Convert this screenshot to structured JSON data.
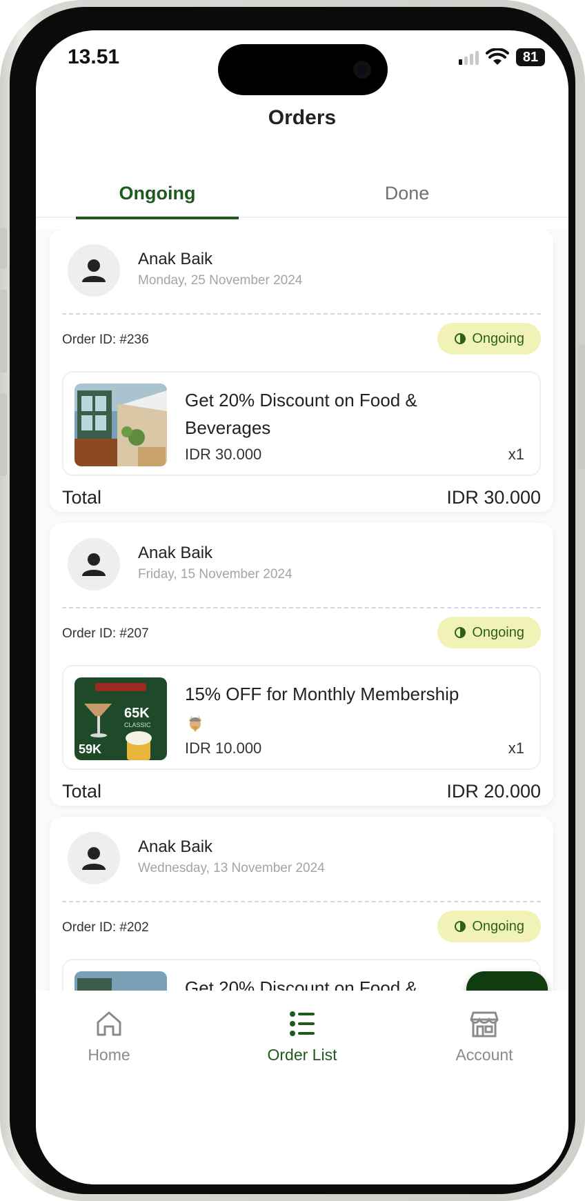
{
  "status_bar": {
    "time": "13.51",
    "battery": "81"
  },
  "header": {
    "title": "Orders"
  },
  "tabs": [
    {
      "label": "Ongoing",
      "active": true
    },
    {
      "label": "Done",
      "active": false
    }
  ],
  "orders": [
    {
      "customer": "Anak Baik",
      "date": "Monday, 25 November 2024",
      "order_id": "Order ID: #236",
      "status": "Ongoing",
      "item": {
        "title": "Get 20% Discount on Food & Beverages",
        "price": "IDR 30.000",
        "qty": "x1"
      },
      "total_label": "Total",
      "total": "IDR 30.000"
    },
    {
      "customer": "Anak Baik",
      "date": "Friday, 15 November 2024",
      "order_id": "Order ID: #207",
      "status": "Ongoing",
      "item": {
        "title": "15% OFF for Monthly Membership",
        "price": "IDR 10.000",
        "qty": "x1",
        "thumb_text_1": "65K",
        "thumb_text_2": "59K",
        "thumb_text_3": "CLASSIC"
      },
      "total_label": "Total",
      "total": "IDR 20.000"
    },
    {
      "customer": "Anak Baik",
      "date": "Wednesday, 13 November 2024",
      "order_id": "Order ID: #202",
      "status": "Ongoing",
      "item": {
        "title": "Get 20% Discount on Food &"
      }
    }
  ],
  "bottom_nav": [
    {
      "label": "Home",
      "icon": "home-icon",
      "active": false
    },
    {
      "label": "Order List",
      "icon": "list-icon",
      "active": true
    },
    {
      "label": "Account",
      "icon": "store-icon",
      "active": false
    }
  ],
  "colors": {
    "primary": "#1d5a1d",
    "pill_bg": "#f1f3b6",
    "fab_bg": "#0f3d0f"
  }
}
